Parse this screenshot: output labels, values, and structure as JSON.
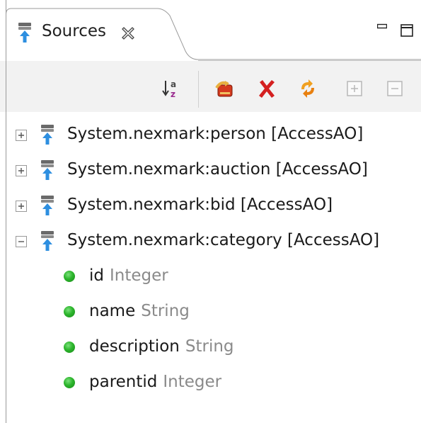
{
  "view": {
    "title": "Sources",
    "icons": {
      "tab": "source-icon",
      "close": "close-icon",
      "minimize": "minimize-icon",
      "maximize": "maximize-icon"
    }
  },
  "toolbar": {
    "buttons": [
      {
        "name": "sort-alphabetical",
        "icon": "sort-az-icon"
      },
      {
        "name": "add-source",
        "icon": "add-source-icon"
      },
      {
        "name": "remove-source",
        "icon": "delete-icon"
      },
      {
        "name": "refresh",
        "icon": "refresh-icon"
      },
      {
        "name": "expand-all",
        "icon": "expand-all-icon"
      },
      {
        "name": "collapse-all",
        "icon": "collapse-all-icon"
      }
    ]
  },
  "tree": {
    "sources": [
      {
        "label": "System.nexmark:person [AccessAO]",
        "expanded": false
      },
      {
        "label": "System.nexmark:auction [AccessAO]",
        "expanded": false
      },
      {
        "label": "System.nexmark:bid [AccessAO]",
        "expanded": false
      },
      {
        "label": "System.nexmark:category [AccessAO]",
        "expanded": true
      }
    ],
    "attributes": [
      {
        "name": "id",
        "type": "Integer"
      },
      {
        "name": "name",
        "type": "String"
      },
      {
        "name": "description",
        "type": "String"
      },
      {
        "name": "parentid",
        "type": "Integer"
      }
    ]
  },
  "colors": {
    "toolbar_bg": "#f2f2f2",
    "tab_border": "#9a9a9a",
    "bullet_green": "#2cb52c",
    "type_gray": "#8a8a8a",
    "delete_red": "#d42020"
  }
}
